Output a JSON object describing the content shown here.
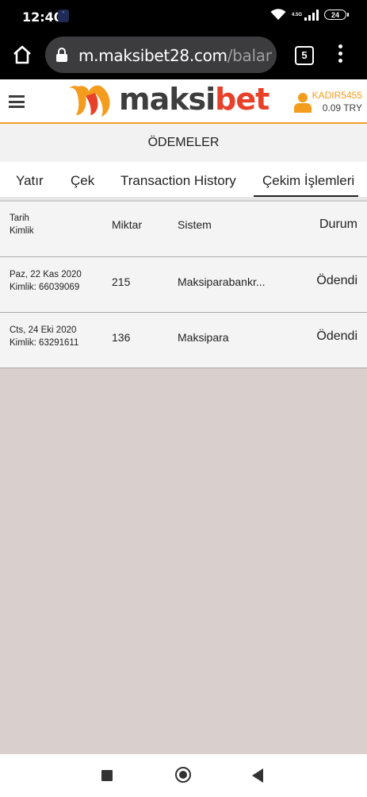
{
  "status_bar": {
    "time": "12:40",
    "network": "4.5G",
    "battery": "24"
  },
  "browser": {
    "url_host": "m.maksibet28.com",
    "url_path": "/balance/",
    "tab_count": "5"
  },
  "site": {
    "logo_text_1": "maksi",
    "logo_text_2": "bet",
    "username": "KADIR5455",
    "balance": "0.09 TRY",
    "brand_color": "#f39c1d",
    "accent_color": "#e8412a"
  },
  "page": {
    "title": "ÖDEMELER"
  },
  "tabs": [
    {
      "label": "Yatır",
      "active": false
    },
    {
      "label": "Çek",
      "active": false
    },
    {
      "label": "Transaction History",
      "active": false
    },
    {
      "label": "Çekim İşlemleri",
      "active": true
    }
  ],
  "table": {
    "headers": {
      "date": "Tarih",
      "id": "Kimlik",
      "amount": "Miktar",
      "system": "Sistem",
      "status": "Durum"
    },
    "rows": [
      {
        "date": "Paz, 22 Kas 2020",
        "id": "Kimlik: 66039069",
        "amount": "215",
        "system": "Maksiparabankr...",
        "status": "Ödendi"
      },
      {
        "date": "Cts, 24 Eki 2020",
        "id": "Kimlik: 63291611",
        "amount": "136",
        "system": "Maksipara",
        "status": "Ödendi"
      }
    ]
  }
}
